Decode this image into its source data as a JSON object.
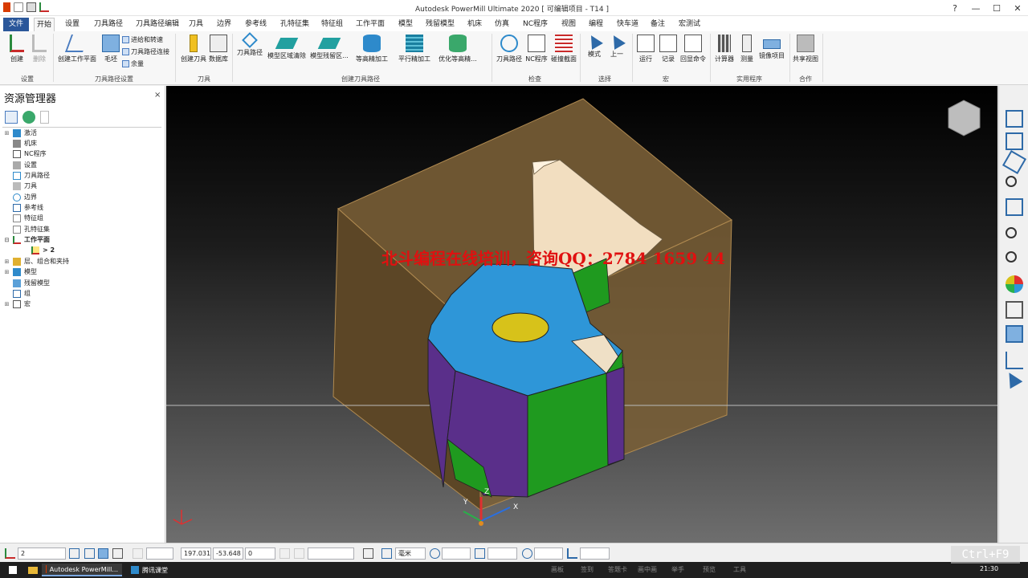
{
  "window": {
    "title": "Autodesk PowerMill Ultimate 2020   [ 可编辑项目 - T14 ]",
    "help": "?",
    "minimize": "—",
    "maximize": "☐",
    "close": "✕"
  },
  "menu_tabs": [
    "文件",
    "开始",
    "设置",
    "刀具路径",
    "刀具路径编辑",
    "刀具",
    "边界",
    "参考线",
    "孔特征集",
    "特征组",
    "工作平面",
    "模型",
    "残留模型",
    "机床",
    "仿真",
    "NC程序",
    "视图",
    "编程",
    "快车道",
    "备注",
    "宏测试"
  ],
  "ribbon": {
    "groups": [
      "设置",
      "刀具路径设置",
      "刀具",
      "创建刀具路径",
      "检查",
      "选择",
      "宏",
      "实用程序",
      "合作"
    ],
    "buttons": {
      "create": "创建",
      "delete": "删除",
      "create_workplane": "创建工作平面",
      "stock": "毛坯",
      "feeds": "进给和转速",
      "connections": "刀具路径连接",
      "allowance": "余量",
      "create_tool": "创建刀具",
      "database": "数据库",
      "toolpaths": "刀具路径",
      "model_area_clear": "模型区域清除",
      "model_rest_area": "模型残留区...",
      "constant_z_finish": "等高精加工",
      "raster_finish": "平行精加工",
      "optimized_constant_z": "优化等高精...",
      "toolpath_check": "刀具路径",
      "nc_check": "NC程序",
      "collision_section": "碰撞截面",
      "mode": "模式",
      "previous": "上一",
      "run": "运行",
      "record": "记录",
      "echo": "回显命令",
      "calculator": "计算器",
      "measure": "测量",
      "mirror_project": "镜像项目",
      "share_view": "共享视图"
    }
  },
  "explorer": {
    "title": "资源管理器",
    "close": "×",
    "items": [
      "激活",
      "机床",
      "NC程序",
      "设置",
      "刀具路径",
      "刀具",
      "边界",
      "参考线",
      "特征组",
      "孔特征集",
      "工作平面",
      "> 2",
      "层、组合和夹持",
      "模型",
      "残留模型",
      "组",
      "宏"
    ]
  },
  "viewport": {
    "watermark": "北斗编程在线培训，咨询QQ：2784 1659 44",
    "triad": {
      "x": "X",
      "y": "Y",
      "z": "Z"
    }
  },
  "statusbar": {
    "workplane": "2",
    "x": "197.031",
    "y": "-53.648",
    "z": "0",
    "units": "毫米"
  },
  "taskbar": {
    "app1": "Autodesk PowerMill...",
    "app2": "腾讯课堂",
    "tray_items": [
      "画板",
      "签到",
      "答题卡",
      "画中画",
      "举手",
      "预览",
      "工具"
    ],
    "clock": "21:30"
  },
  "overlay": {
    "shortcut": "Ctrl+F9"
  },
  "colors": {
    "accent": "#2b579a",
    "watermark": "#e01010",
    "box": "#8a6c3c"
  }
}
